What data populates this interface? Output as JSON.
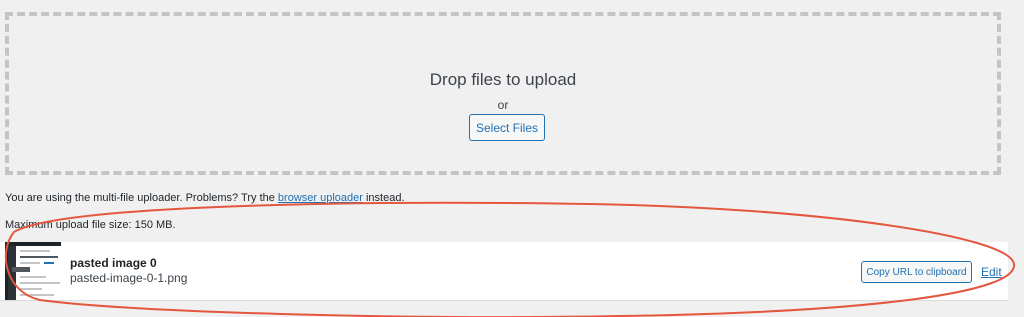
{
  "dropzone": {
    "title": "Drop files to upload",
    "or_text": "or",
    "select_button_label": "Select Files"
  },
  "uploader_notice": {
    "prefix": "You are using the multi-file uploader. Problems? Try the ",
    "link_text": "browser uploader",
    "suffix": " instead."
  },
  "max_upload": {
    "text": "Maximum upload file size: 150 MB."
  },
  "uploaded_item": {
    "title": "pasted image 0",
    "filename": "pasted-image-0-1.png",
    "copy_button_label": "Copy URL to clipboard",
    "edit_label": "Edit",
    "thumbnail_icon": "image-thumbnail"
  },
  "colors": {
    "accent": "#2271b1",
    "annotation": "#e4573f",
    "background": "#f0f0f1",
    "dash_border": "#c3c4c7"
  }
}
